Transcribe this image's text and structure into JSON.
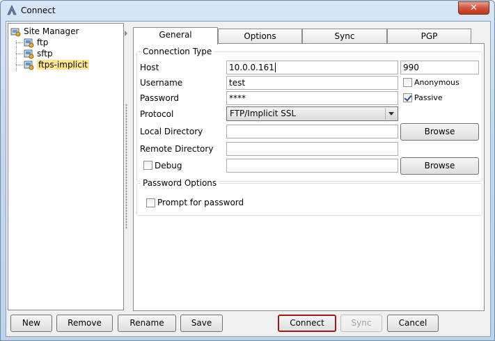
{
  "window": {
    "title": "Connect",
    "close_glyph": "✕"
  },
  "tree": {
    "root_label": "Site Manager",
    "items": [
      {
        "label": "ftp"
      },
      {
        "label": "sftp"
      },
      {
        "label": "ftps-implicit",
        "selected": true
      }
    ]
  },
  "tabs": [
    "General",
    "Options",
    "Sync",
    "PGP"
  ],
  "active_tab": "General",
  "connection_type": {
    "legend": "Connection Type",
    "host_label": "Host",
    "host_value": "10.0.0.161",
    "port_value": "990",
    "username_label": "Username",
    "username_value": "test",
    "anonymous_label": "Anonymous",
    "anonymous_checked": false,
    "password_label": "Password",
    "password_value": "****",
    "passive_label": "Passive",
    "passive_checked": true,
    "protocol_label": "Protocol",
    "protocol_value": "FTP/Implicit SSL",
    "local_dir_label": "Local Directory",
    "local_dir_value": "",
    "browse_label": "Browse",
    "remote_dir_label": "Remote Directory",
    "remote_dir_value": "",
    "debug_label": "Debug",
    "debug_checked": false,
    "debug_value": ""
  },
  "password_options": {
    "legend": "Password Options",
    "prompt_label": "Prompt for password",
    "prompt_checked": false
  },
  "buttons": {
    "new": "New",
    "remove": "Remove",
    "rename": "Rename",
    "save": "Save",
    "connect": "Connect",
    "sync": "Sync",
    "cancel": "Cancel"
  },
  "colors": {
    "selection": "#ffe68c",
    "default_button_border": "#a01818",
    "close_button": "#c2361c"
  }
}
